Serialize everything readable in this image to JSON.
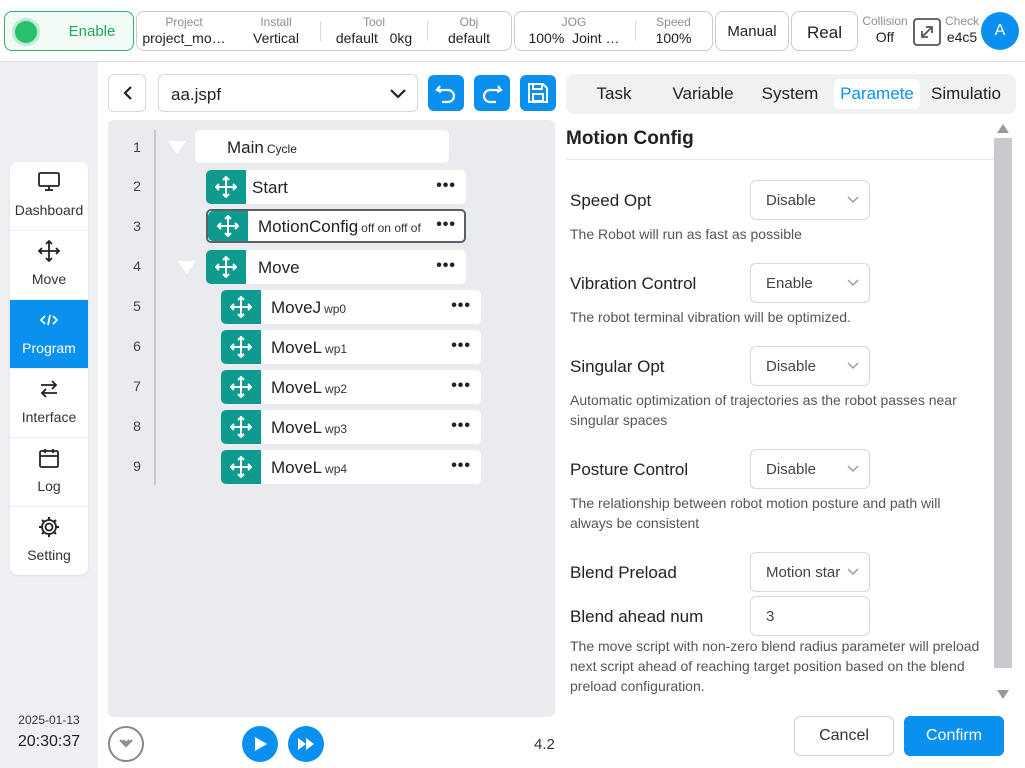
{
  "topbar": {
    "enable_label": "Enable",
    "project": {
      "caption": "Project",
      "value": "project_mo…"
    },
    "install": {
      "caption": "Install",
      "value": "Vertical"
    },
    "tool": {
      "caption": "Tool",
      "value": "default",
      "value2": "0kg"
    },
    "obj": {
      "caption": "Obj",
      "value": "default"
    },
    "jog": {
      "caption": "JOG",
      "value": "100%",
      "value2": "Joint …"
    },
    "speed": {
      "caption": "Speed",
      "value": "100%"
    },
    "mode_label": "Manual",
    "real_label": "Real",
    "collision": {
      "caption": "Collision",
      "value": "Off"
    },
    "check": {
      "caption": "Check",
      "value": "e4c5"
    },
    "avatar_letter": "A"
  },
  "nav": {
    "items": [
      {
        "label": "Dashboard",
        "icon": "monitor-icon"
      },
      {
        "label": "Move",
        "icon": "move-arrows-icon"
      },
      {
        "label": "Program",
        "icon": "code-icon"
      },
      {
        "label": "Interface",
        "icon": "swap-arrows-icon"
      },
      {
        "label": "Log",
        "icon": "calendar-icon"
      },
      {
        "label": "Setting",
        "icon": "gear-icon"
      }
    ],
    "active": "Program"
  },
  "clock": {
    "date": "2025-01-13",
    "time": "20:30:37"
  },
  "editor": {
    "file_name": "aa.jspf",
    "version": "4.2",
    "line_numbers": [
      "1",
      "2",
      "3",
      "4",
      "5",
      "6",
      "7",
      "8",
      "9"
    ],
    "tree": {
      "main": {
        "name": "Main",
        "tag": "Cycle"
      },
      "start": {
        "name": "Start",
        "tag": ""
      },
      "motion_config": {
        "name": "MotionConfig",
        "tag": "off on off of"
      },
      "move": {
        "name": "Move",
        "tag": ""
      },
      "children": [
        {
          "name": "MoveJ",
          "tag": "wp0"
        },
        {
          "name": "MoveL",
          "tag": "wp1"
        },
        {
          "name": "MoveL",
          "tag": "wp2"
        },
        {
          "name": "MoveL",
          "tag": "wp3"
        },
        {
          "name": "MoveL",
          "tag": "wp4"
        }
      ]
    },
    "more_label": "•••"
  },
  "tabs": [
    {
      "label": "Task"
    },
    {
      "label": "Variable"
    },
    {
      "label": "System"
    },
    {
      "label": "Paramete"
    },
    {
      "label": "Simulatio"
    }
  ],
  "active_tab": "Paramete",
  "config": {
    "title": "Motion Config",
    "speed_opt": {
      "label": "Speed Opt",
      "value": "Disable",
      "desc": "The Robot will run as fast as possible"
    },
    "vibration": {
      "label": "Vibration Control",
      "value": "Enable",
      "desc": "The robot terminal vibration will be optimized."
    },
    "singular": {
      "label": "Singular Opt",
      "value": "Disable",
      "desc": "Automatic optimization of trajectories as the robot passes near singular spaces"
    },
    "posture": {
      "label": "Posture Control",
      "value": "Disable",
      "desc": "The relationship between robot motion posture and path will always be consistent"
    },
    "blend_preload": {
      "label": "Blend Preload",
      "value": "Motion star"
    },
    "blend_ahead": {
      "label": "Blend ahead num",
      "value": "3",
      "desc": "The move script with non-zero blend radius parameter will preload next script ahead of reaching target position based on the blend preload configuration."
    },
    "cancel_label": "Cancel",
    "confirm_label": "Confirm"
  },
  "colors": {
    "accent": "#0a91f0",
    "node_icon": "#0e9a8f",
    "enable_green": "#27c06d"
  }
}
